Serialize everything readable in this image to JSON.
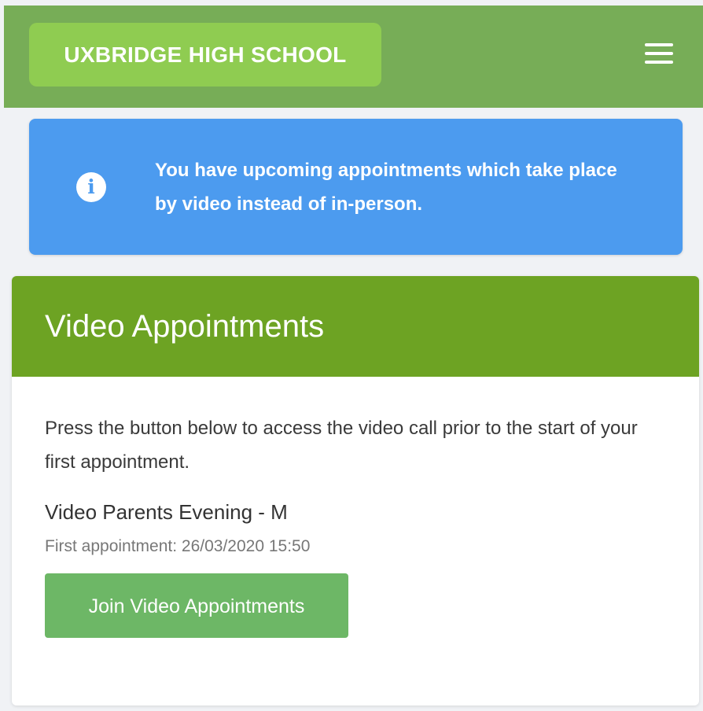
{
  "header": {
    "school_name": "UXBRIDGE HIGH SCHOOL",
    "menu_icon": "hamburger-menu-icon",
    "bar_color": "#77ad57",
    "brand_color": "#8fcc51"
  },
  "alert": {
    "icon": "info-icon",
    "message": "You have upcoming appointments which take place by video instead of in-person.",
    "color": "#4c9bef"
  },
  "card": {
    "title": "Video Appointments",
    "header_color": "#6da323",
    "description": "Press the button below to access the video call prior to the start of your first appointment.",
    "event_title": "Video Parents Evening - M",
    "first_appointment": "First appointment: 26/03/2020 15:50",
    "join_button_label": "Join Video Appointments",
    "button_color": "#6db766"
  }
}
